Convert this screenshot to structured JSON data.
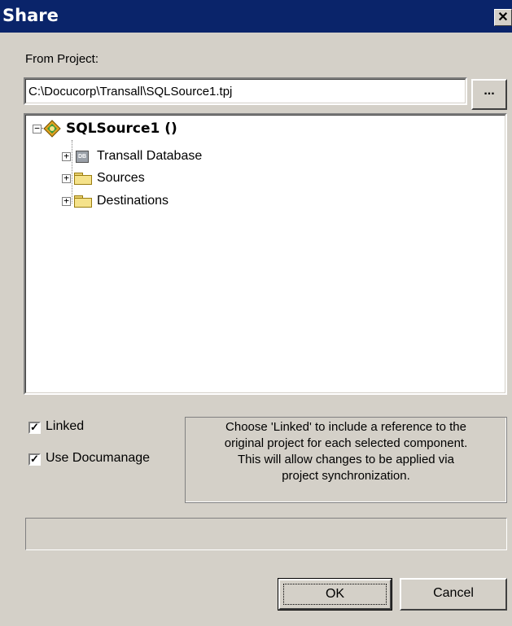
{
  "window": {
    "title": "Share",
    "close_symbol": "✕"
  },
  "from_project": {
    "label": "From Project:",
    "path": "C:\\Docucorp\\Transall\\SQLSource1.tpj",
    "browse_label": "..."
  },
  "tree": {
    "root": {
      "label": "SQLSource1 ()",
      "expander": "−"
    },
    "children": [
      {
        "label": "Transall Database",
        "icon": "database-icon",
        "expander": "+"
      },
      {
        "label": "Sources",
        "icon": "folder-icon",
        "expander": "+"
      },
      {
        "label": "Destinations",
        "icon": "folder-icon",
        "expander": "+"
      }
    ]
  },
  "options": {
    "linked": {
      "label": "Linked",
      "checked": true,
      "mark": "✓"
    },
    "use_documanage": {
      "label": "Use Documanage",
      "checked": true,
      "mark": "✓"
    }
  },
  "info_text": {
    "line1": "Choose 'Linked' to include a reference to the",
    "line2": "original project for each selected component.",
    "line3": "This will allow changes to be applied via",
    "line4": "project synchronization."
  },
  "status": {
    "text": ""
  },
  "buttons": {
    "ok": "OK",
    "cancel": "Cancel"
  },
  "colors": {
    "title_bar": "#0a246a",
    "dialog_bg": "#d4d0c8",
    "folder": "#f5e28a"
  }
}
